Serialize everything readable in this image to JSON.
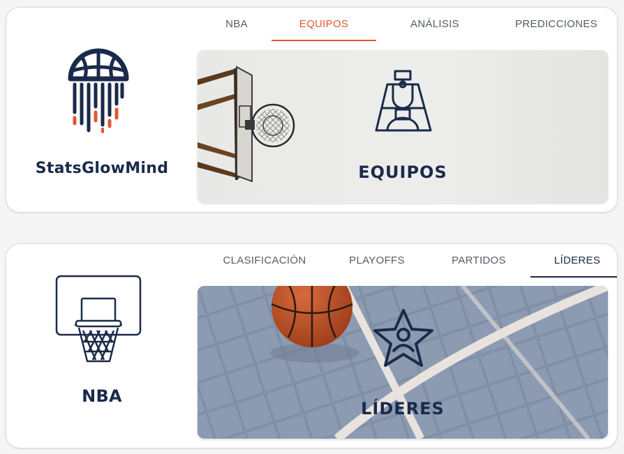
{
  "colors": {
    "navy": "#1b2a4a",
    "accent_orange": "#e2582e",
    "tab_text": "#555b66"
  },
  "section1": {
    "brand_name": "StatsGlowMind",
    "brand_icon": "glowing-basketball-jellyfish-logo",
    "tabs": [
      {
        "label": "NBA",
        "active": false
      },
      {
        "label": "EQUIPOS",
        "active": true
      },
      {
        "label": "ANÁLISIS",
        "active": false
      },
      {
        "label": "PREDICCIONES",
        "active": false
      }
    ],
    "panel": {
      "title": "EQUIPOS",
      "icon": "basketball-court-icon",
      "background": "basketball-hoop-photo"
    }
  },
  "section2": {
    "brand_name": "NBA",
    "brand_icon": "basketball-hoop-icon",
    "tabs": [
      {
        "label": "CLASIFICACIÓN",
        "active": false
      },
      {
        "label": "PLAYOFFS",
        "active": false
      },
      {
        "label": "PARTIDOS",
        "active": false
      },
      {
        "label": "LÍDERES",
        "active": true
      }
    ],
    "panel": {
      "title": "LÍDERES",
      "icon": "star-player-icon",
      "background": "basketball-on-court-photo"
    }
  }
}
